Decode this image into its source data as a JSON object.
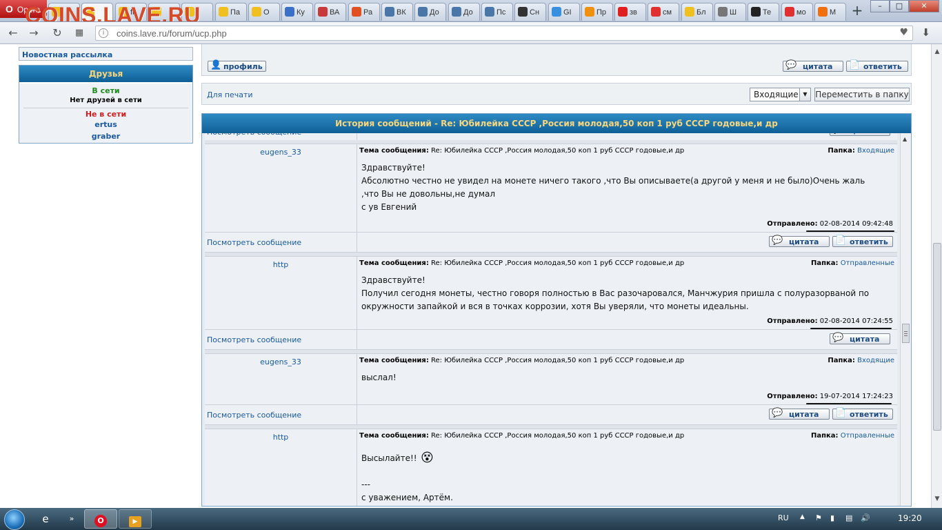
{
  "browser": {
    "menu_label": "Opera",
    "watermark": "COINS.LAVE.RU",
    "tabs": [
      {
        "label": "",
        "color": "#f0c020"
      },
      {
        "label": "",
        "color": "#f0c020",
        "active": true
      },
      {
        "label": "fil",
        "color": "#f0c020"
      },
      {
        "label": "",
        "color": "#f0c020"
      },
      {
        "label": "",
        "color": "#f0c020"
      },
      {
        "label": "Па",
        "color": "#f0c020"
      },
      {
        "label": "О",
        "color": "#f0c020"
      },
      {
        "label": "Ку",
        "color": "#3a70c8"
      },
      {
        "label": "ВА",
        "color": "#c83a3a"
      },
      {
        "label": "Ра",
        "color": "#e05020"
      },
      {
        "label": "ВК",
        "color": "#4a76a8"
      },
      {
        "label": "До",
        "color": "#4a76a8"
      },
      {
        "label": "До",
        "color": "#4a76a8"
      },
      {
        "label": "Пс",
        "color": "#4a76a8"
      },
      {
        "label": "Сн",
        "color": "#333333"
      },
      {
        "label": "GI",
        "color": "#3a90e0"
      },
      {
        "label": "Пр",
        "color": "#f09010"
      },
      {
        "label": "зв",
        "color": "#e02020"
      },
      {
        "label": "см",
        "color": "#e03030"
      },
      {
        "label": "Бл",
        "color": "#f0c020"
      },
      {
        "label": "Ш",
        "color": "#777777"
      },
      {
        "label": "Те",
        "color": "#222222"
      },
      {
        "label": "мо",
        "color": "#e03030"
      },
      {
        "label": "М",
        "color": "#f07010"
      }
    ],
    "url": "coins.lave.ru/forum/ucp.php"
  },
  "sidebar": {
    "newsletter": "Новостная рассылка",
    "friends_title": "Друзья",
    "online_label": "В сети",
    "no_online": "Нет друзей в сети",
    "offline_label": "Не в сети",
    "offline": [
      "ertus",
      "graber"
    ]
  },
  "toolbar": {
    "profile": "профиль",
    "quote": "цитата",
    "reply": "ответить"
  },
  "actions": {
    "print": "Для печати",
    "folder_select": "Входящие",
    "move_button": "Переместить в папку"
  },
  "history": {
    "title": "История сообщений - Re: Юбилейка СССР ,Россия молодая,50 коп 1 руб СССР годовые,и др",
    "subject_label": "Тема сообщения:",
    "folder_label": "Папка:",
    "sent_label": "Отправлено:",
    "view_label": "Посмотреть сообщение",
    "quote_label": "цитата",
    "reply_label": "ответить",
    "messages": [
      {
        "author": "eugens_33",
        "subject": "Re: Юбилейка СССР ,Россия молодая,50 коп 1 руб СССР годовые,и др",
        "folder": "Входящие",
        "lines": [
          "Здравствуйте!",
          "Абсолютно честно не увидел на монете ничего такого ,что Вы описываете(а другой у меня и не было)Очень жаль",
          ",что Вы не довольны,не думал",
          "с ув Евгений"
        ],
        "sent": "02-08-2014 09:42:48"
      },
      {
        "author": "http",
        "subject": "Re: Юбилейка СССР ,Россия молодая,50 коп 1 руб СССР годовые,и др",
        "folder": "Отправленные",
        "lines": [
          "Здравствуйте!",
          "Получил сегодня монеты, честно говоря полностью в Вас разочаровался, Манчжурия пришла с полуразорваной по",
          "окружности запайкой и вся в точках коррозии, хотя Вы уверяли, что монеты идеальны."
        ],
        "sent": "02-08-2014 07:24:55"
      },
      {
        "author": "eugens_33",
        "subject": "Re: Юбилейка СССР ,Россия молодая,50 коп 1 руб СССР годовые,и др",
        "folder": "Входящие",
        "lines": [
          "выслал!"
        ],
        "sent": "19-07-2014 17:24:23"
      },
      {
        "author": "http",
        "subject": "Re: Юбилейка СССР ,Россия молодая,50 коп 1 руб СССР годовые,и др",
        "folder": "Отправленные",
        "lines": [
          "Высылайте!!",
          "",
          "---",
          "с уважением, Артём."
        ]
      }
    ]
  },
  "taskbar": {
    "lang": "RU",
    "clock": "19:20"
  }
}
